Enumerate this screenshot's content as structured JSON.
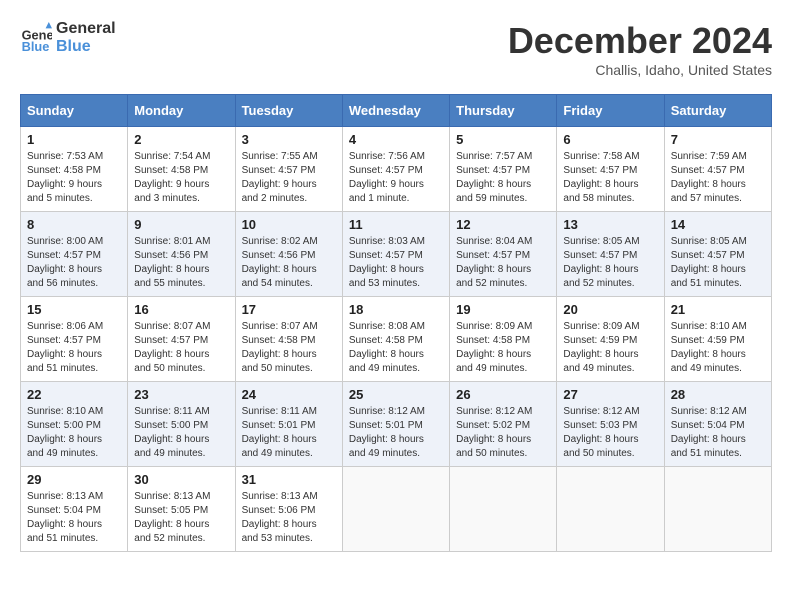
{
  "header": {
    "logo_line1": "General",
    "logo_line2": "Blue",
    "month_title": "December 2024",
    "location": "Challis, Idaho, United States"
  },
  "days_of_week": [
    "Sunday",
    "Monday",
    "Tuesday",
    "Wednesday",
    "Thursday",
    "Friday",
    "Saturday"
  ],
  "weeks": [
    [
      {
        "day": "1",
        "sunrise": "7:53 AM",
        "sunset": "4:58 PM",
        "daylight": "9 hours and 5 minutes."
      },
      {
        "day": "2",
        "sunrise": "7:54 AM",
        "sunset": "4:58 PM",
        "daylight": "9 hours and 3 minutes."
      },
      {
        "day": "3",
        "sunrise": "7:55 AM",
        "sunset": "4:57 PM",
        "daylight": "9 hours and 2 minutes."
      },
      {
        "day": "4",
        "sunrise": "7:56 AM",
        "sunset": "4:57 PM",
        "daylight": "9 hours and 1 minute."
      },
      {
        "day": "5",
        "sunrise": "7:57 AM",
        "sunset": "4:57 PM",
        "daylight": "8 hours and 59 minutes."
      },
      {
        "day": "6",
        "sunrise": "7:58 AM",
        "sunset": "4:57 PM",
        "daylight": "8 hours and 58 minutes."
      },
      {
        "day": "7",
        "sunrise": "7:59 AM",
        "sunset": "4:57 PM",
        "daylight": "8 hours and 57 minutes."
      }
    ],
    [
      {
        "day": "8",
        "sunrise": "8:00 AM",
        "sunset": "4:57 PM",
        "daylight": "8 hours and 56 minutes."
      },
      {
        "day": "9",
        "sunrise": "8:01 AM",
        "sunset": "4:56 PM",
        "daylight": "8 hours and 55 minutes."
      },
      {
        "day": "10",
        "sunrise": "8:02 AM",
        "sunset": "4:56 PM",
        "daylight": "8 hours and 54 minutes."
      },
      {
        "day": "11",
        "sunrise": "8:03 AM",
        "sunset": "4:57 PM",
        "daylight": "8 hours and 53 minutes."
      },
      {
        "day": "12",
        "sunrise": "8:04 AM",
        "sunset": "4:57 PM",
        "daylight": "8 hours and 52 minutes."
      },
      {
        "day": "13",
        "sunrise": "8:05 AM",
        "sunset": "4:57 PM",
        "daylight": "8 hours and 52 minutes."
      },
      {
        "day": "14",
        "sunrise": "8:05 AM",
        "sunset": "4:57 PM",
        "daylight": "8 hours and 51 minutes."
      }
    ],
    [
      {
        "day": "15",
        "sunrise": "8:06 AM",
        "sunset": "4:57 PM",
        "daylight": "8 hours and 51 minutes."
      },
      {
        "day": "16",
        "sunrise": "8:07 AM",
        "sunset": "4:57 PM",
        "daylight": "8 hours and 50 minutes."
      },
      {
        "day": "17",
        "sunrise": "8:07 AM",
        "sunset": "4:58 PM",
        "daylight": "8 hours and 50 minutes."
      },
      {
        "day": "18",
        "sunrise": "8:08 AM",
        "sunset": "4:58 PM",
        "daylight": "8 hours and 49 minutes."
      },
      {
        "day": "19",
        "sunrise": "8:09 AM",
        "sunset": "4:58 PM",
        "daylight": "8 hours and 49 minutes."
      },
      {
        "day": "20",
        "sunrise": "8:09 AM",
        "sunset": "4:59 PM",
        "daylight": "8 hours and 49 minutes."
      },
      {
        "day": "21",
        "sunrise": "8:10 AM",
        "sunset": "4:59 PM",
        "daylight": "8 hours and 49 minutes."
      }
    ],
    [
      {
        "day": "22",
        "sunrise": "8:10 AM",
        "sunset": "5:00 PM",
        "daylight": "8 hours and 49 minutes."
      },
      {
        "day": "23",
        "sunrise": "8:11 AM",
        "sunset": "5:00 PM",
        "daylight": "8 hours and 49 minutes."
      },
      {
        "day": "24",
        "sunrise": "8:11 AM",
        "sunset": "5:01 PM",
        "daylight": "8 hours and 49 minutes."
      },
      {
        "day": "25",
        "sunrise": "8:12 AM",
        "sunset": "5:01 PM",
        "daylight": "8 hours and 49 minutes."
      },
      {
        "day": "26",
        "sunrise": "8:12 AM",
        "sunset": "5:02 PM",
        "daylight": "8 hours and 50 minutes."
      },
      {
        "day": "27",
        "sunrise": "8:12 AM",
        "sunset": "5:03 PM",
        "daylight": "8 hours and 50 minutes."
      },
      {
        "day": "28",
        "sunrise": "8:12 AM",
        "sunset": "5:04 PM",
        "daylight": "8 hours and 51 minutes."
      }
    ],
    [
      {
        "day": "29",
        "sunrise": "8:13 AM",
        "sunset": "5:04 PM",
        "daylight": "8 hours and 51 minutes."
      },
      {
        "day": "30",
        "sunrise": "8:13 AM",
        "sunset": "5:05 PM",
        "daylight": "8 hours and 52 minutes."
      },
      {
        "day": "31",
        "sunrise": "8:13 AM",
        "sunset": "5:06 PM",
        "daylight": "8 hours and 53 minutes."
      },
      null,
      null,
      null,
      null
    ]
  ]
}
